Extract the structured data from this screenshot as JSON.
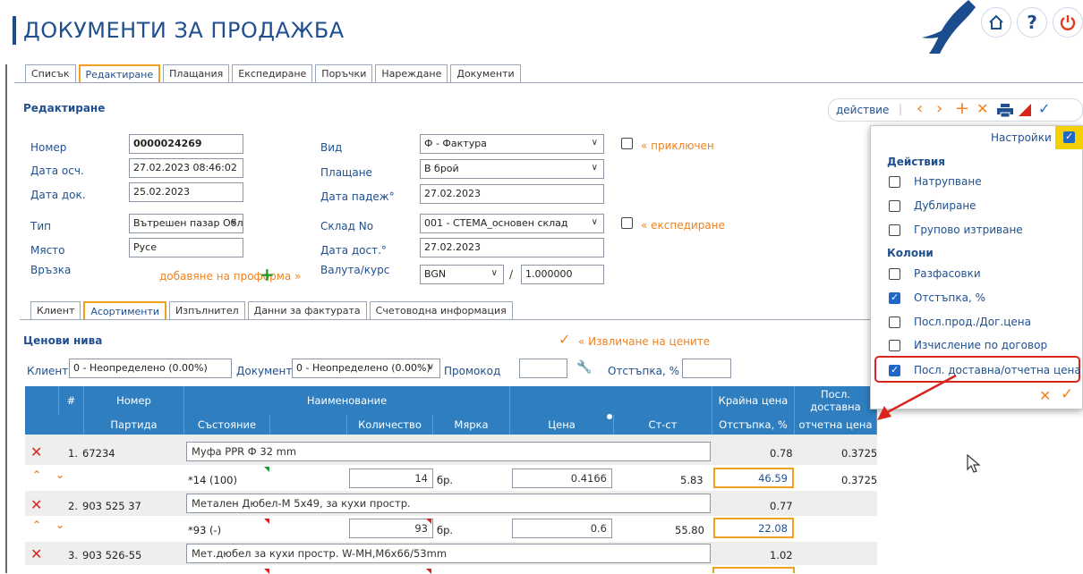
{
  "header": {
    "title": "ДОКУМЕНТИ ЗА ПРОДАЖБА",
    "home_icon": "home-icon",
    "help_label": "?",
    "power_icon": "power-icon"
  },
  "main_tabs": [
    "Списък",
    "Редактиране",
    "Плащания",
    "Експедиране",
    "Поръчки",
    "Нареждане",
    "Документи"
  ],
  "editor": {
    "section_title": "Редактиране",
    "action_label": "действие",
    "toolbar_icons": [
      "prev-icon",
      "next-icon",
      "add-icon",
      "delete-icon",
      "print-icon",
      "flag-icon",
      "confirm-icon"
    ]
  },
  "form": {
    "number_label": "Номер",
    "number_value": "0000024269",
    "date_acc_label": "Дата осч.",
    "date_acc_value": "27.02.2023 08:46:02",
    "date_doc_label": "Дата док.",
    "date_doc_value": "25.02.2023",
    "type_label": "Тип",
    "type_value": "Вътрешен пазар Облагаеми с",
    "place_label": "Място",
    "place_value": "Русе",
    "link_label": "Връзка",
    "add_proforma": "добавяне на проформа »",
    "kind_label": "Вид",
    "kind_value": "Ф - Фактура",
    "payment_label": "Плащане",
    "payment_value": "В брой",
    "due_label": "Дата падеж°",
    "due_value": "27.02.2023",
    "warehouse_label": "Склад No",
    "warehouse_value": "001 - СТЕМА_основен склад",
    "delivery_date_label": "Дата дост.°",
    "delivery_date_value": "27.02.2023",
    "currency_label": "Валута/курс",
    "currency_value": "BGN",
    "rate_sep": "/",
    "rate_value": "1.000000",
    "closed_label": "« приключен",
    "shipping_label": "« експедиране"
  },
  "sub_tabs": [
    "Клиент",
    "Асортименти",
    "Изпълнител",
    "Данни за фактурата",
    "Счетоводна информация"
  ],
  "price_levels": {
    "title": "Ценови нива",
    "extract_label": "« Извличане на цените",
    "client_label": "Клиент",
    "client_value": "0 - Неопределено (0.00%)",
    "document_label": "Документ",
    "document_value": "0 - Неопределено (0.00%)",
    "promo_label": "Промокод",
    "promo_value": "",
    "discount_label": "Отстъпка, %",
    "discount_value": ""
  },
  "grid": {
    "head1": {
      "num": "#",
      "code": "Номер",
      "name": "Наименование",
      "final_price": "Крайна цена",
      "last_delivery": "Посл. доставна"
    },
    "head2": {
      "batch": "Партида",
      "state": "Състояние",
      "qty": "Количество",
      "unit": "Мярка",
      "price": "Цена",
      "value": "Ст-ст",
      "discount": "Отстъпка, %",
      "report_price": "отчетна цена"
    },
    "rows": [
      {
        "idx": "1.",
        "code": "67234",
        "name": "Муфа PPR Ф 32 mm",
        "final": "0.78",
        "last": "0.3725",
        "state": "*14 (100)",
        "qty": "14",
        "unit": "бр.",
        "price": "0.4166",
        "value": "5.83",
        "discount": "46.59",
        "report": "0.3725"
      },
      {
        "idx": "2.",
        "code": "903 525 37",
        "name": "Метален Дюбел-М 5х49, за кухи простр.",
        "final": "0.77",
        "last": "",
        "state": "*93 (-)",
        "qty": "93",
        "unit": "бр.",
        "price": "0.6",
        "value": "55.80",
        "discount": "22.08",
        "report": ""
      },
      {
        "idx": "3.",
        "code": "903 526-55",
        "name": "Мет.дюбел за кухи простр. W-MH,M6x66/53mm",
        "final": "1.02",
        "last": ""
      }
    ]
  },
  "settings_popup": {
    "title": "Настройки",
    "actions_header": "Действия",
    "actions": [
      {
        "label": "Натрупване",
        "checked": false
      },
      {
        "label": "Дублиране",
        "checked": false
      },
      {
        "label": "Групово изтриване",
        "checked": false
      }
    ],
    "columns_header": "Колони",
    "columns": [
      {
        "label": "Разфасовки",
        "checked": false
      },
      {
        "label": "Отстъпка, %",
        "checked": true
      },
      {
        "label": "Посл.прод./Дог.цена",
        "checked": false
      },
      {
        "label": "Изчисление по договор",
        "checked": false
      },
      {
        "label": "Посл. доставна/отчетна цена",
        "checked": true
      }
    ]
  },
  "colors": {
    "accent_blue": "#1f4f8f",
    "header_blue": "#2f7fc0",
    "orange": "#f0821e",
    "red": "#d9261c"
  }
}
